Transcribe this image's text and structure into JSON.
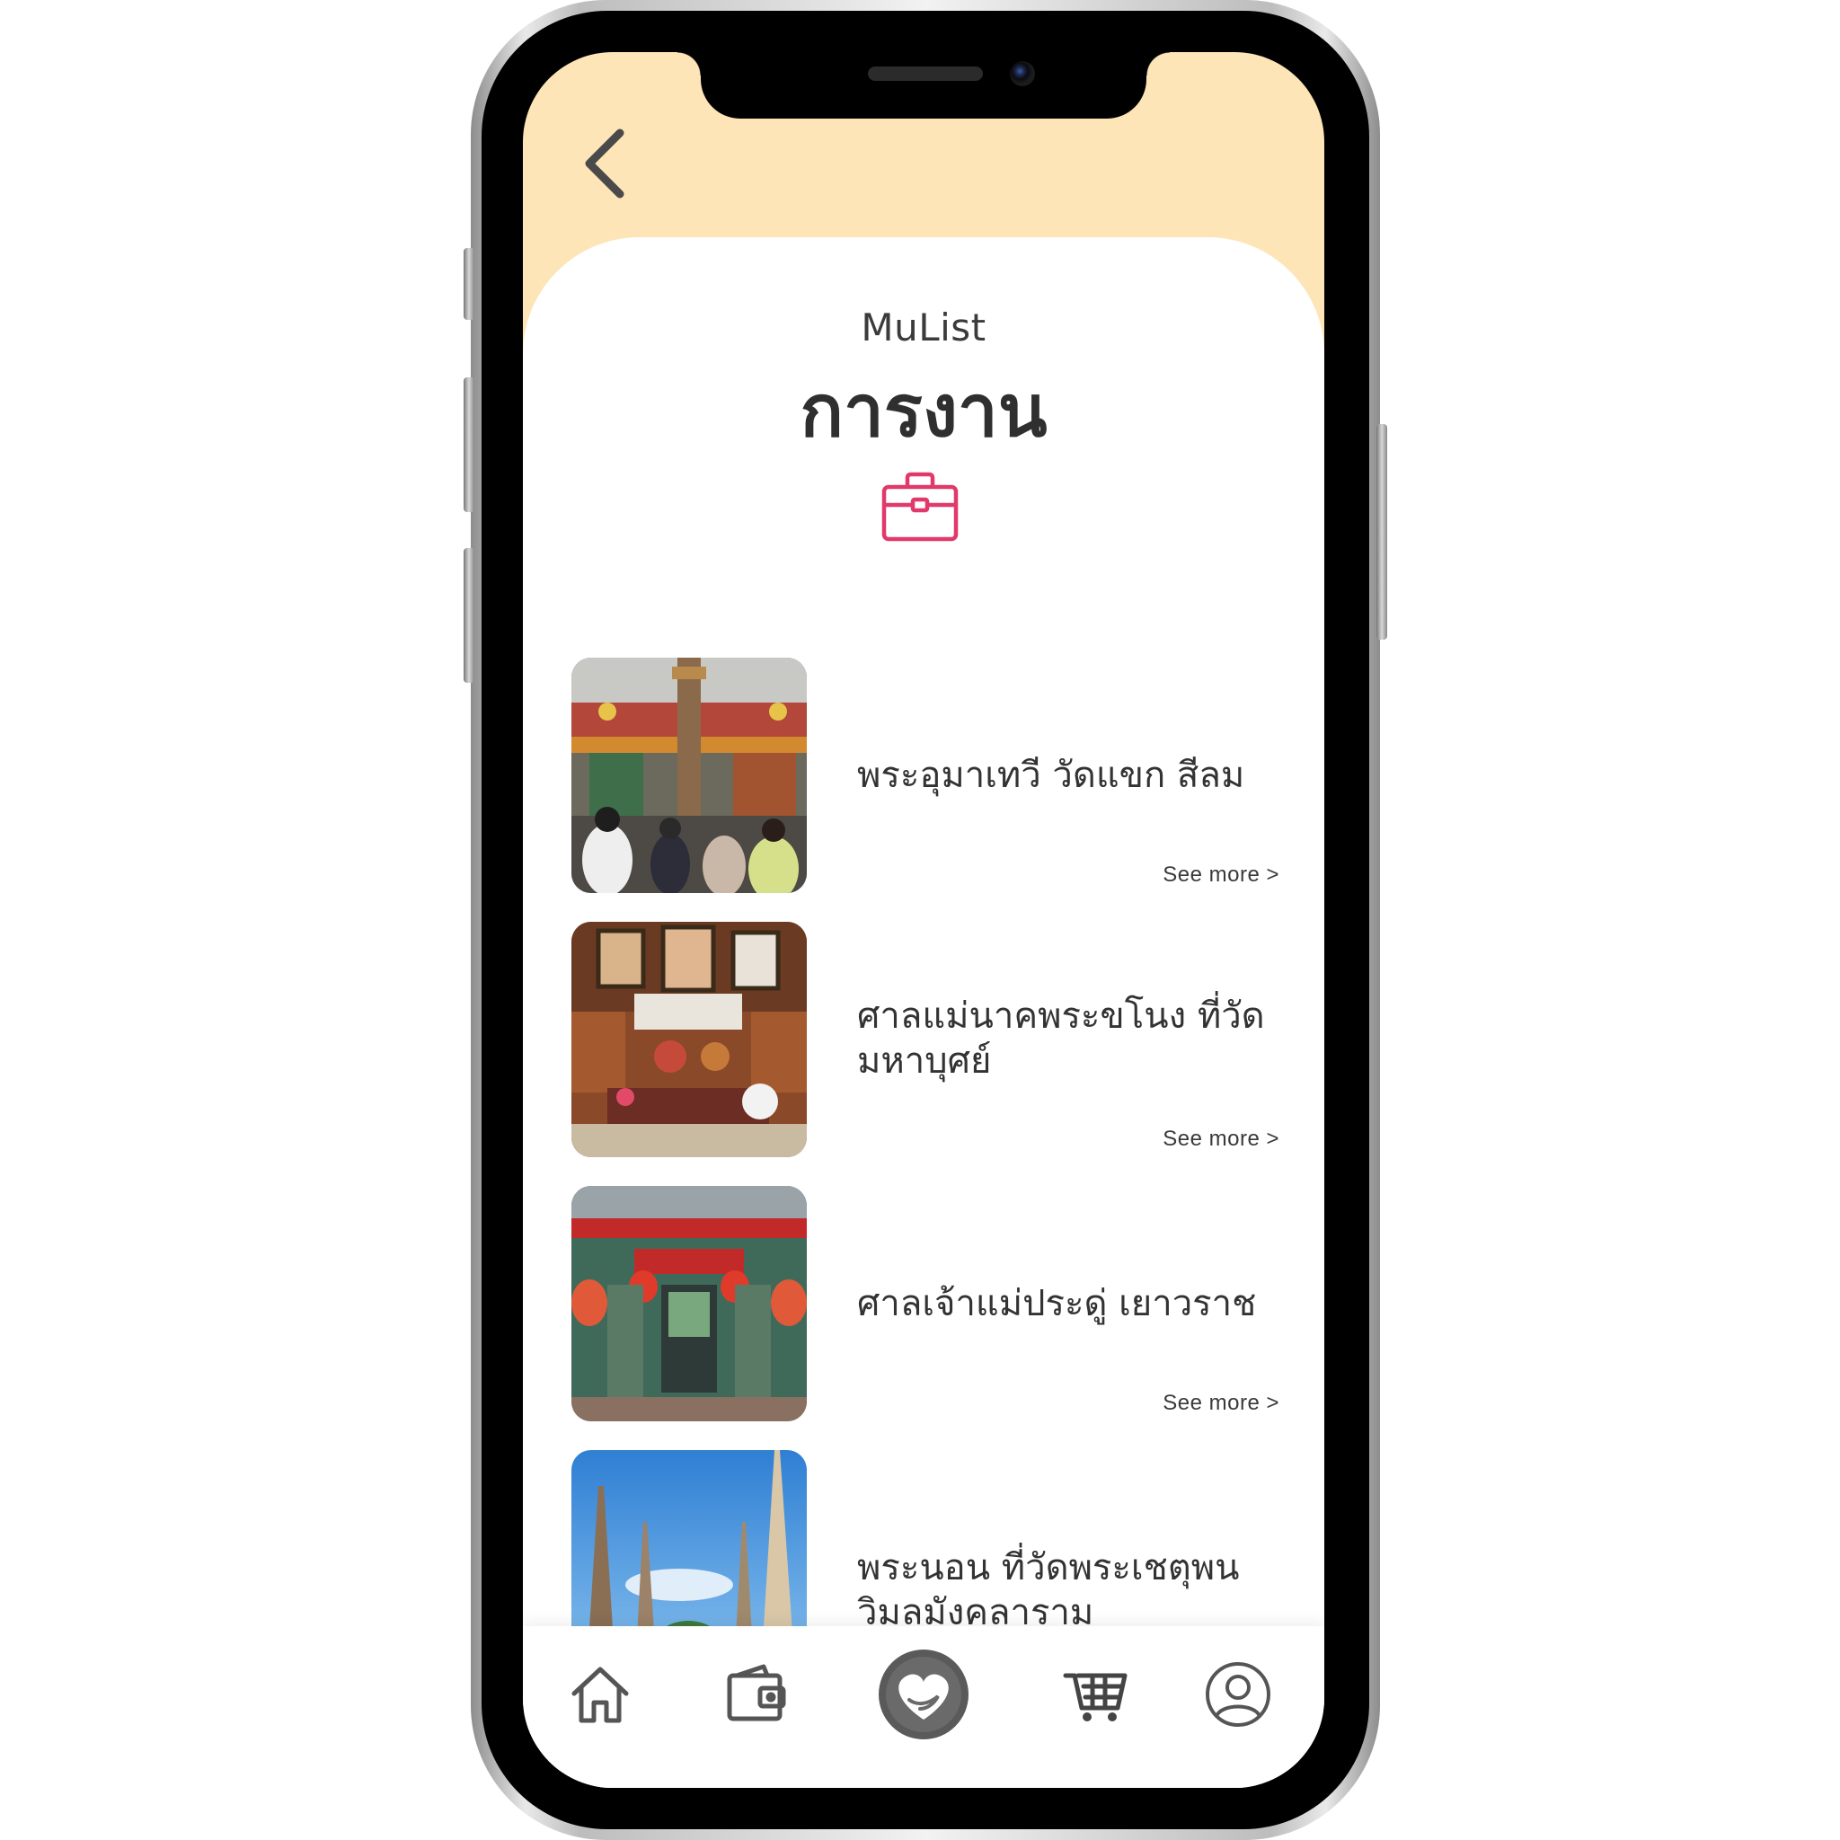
{
  "header": {
    "app_name": "MuList",
    "title": "การงาน",
    "back_icon": "chevron-left-icon",
    "category_icon": "briefcase-icon",
    "accent_color": "#e0396a",
    "header_bg": "#fde5b7"
  },
  "items": [
    {
      "title": "พระอุมาเทวี วัดแขก สีลม",
      "see_more": "See more >",
      "image": "hindu-temple-photo"
    },
    {
      "title": "ศาลแม่นาคพระขโนง ที่วัดมหาบุศย์",
      "see_more": "See more >",
      "image": "shrine-photo"
    },
    {
      "title": "ศาลเจ้าแม่ประดู่ เยาวราช",
      "see_more": "See more >",
      "image": "chinese-shrine-photo"
    },
    {
      "title": "พระนอน ที่วัดพระเชตุพนวิมลมังคลาราม",
      "see_more": "",
      "image": "stupa-photo"
    }
  ],
  "tabbar": {
    "tabs": [
      "home-icon",
      "wallet-icon",
      "heart-hand-icon",
      "cart-icon",
      "profile-icon"
    ],
    "active": "heart-hand-icon"
  }
}
